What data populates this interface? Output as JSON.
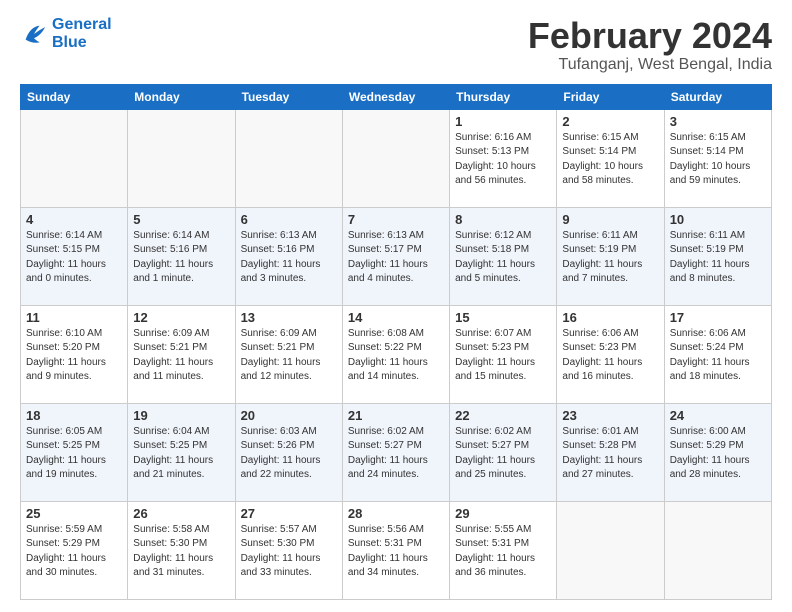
{
  "header": {
    "logo_line1": "General",
    "logo_line2": "Blue",
    "month": "February 2024",
    "location": "Tufanganj, West Bengal, India"
  },
  "weekdays": [
    "Sunday",
    "Monday",
    "Tuesday",
    "Wednesday",
    "Thursday",
    "Friday",
    "Saturday"
  ],
  "weeks": [
    [
      {
        "day": "",
        "info": ""
      },
      {
        "day": "",
        "info": ""
      },
      {
        "day": "",
        "info": ""
      },
      {
        "day": "",
        "info": ""
      },
      {
        "day": "1",
        "info": "Sunrise: 6:16 AM\nSunset: 5:13 PM\nDaylight: 10 hours\nand 56 minutes."
      },
      {
        "day": "2",
        "info": "Sunrise: 6:15 AM\nSunset: 5:14 PM\nDaylight: 10 hours\nand 58 minutes."
      },
      {
        "day": "3",
        "info": "Sunrise: 6:15 AM\nSunset: 5:14 PM\nDaylight: 10 hours\nand 59 minutes."
      }
    ],
    [
      {
        "day": "4",
        "info": "Sunrise: 6:14 AM\nSunset: 5:15 PM\nDaylight: 11 hours\nand 0 minutes."
      },
      {
        "day": "5",
        "info": "Sunrise: 6:14 AM\nSunset: 5:16 PM\nDaylight: 11 hours\nand 1 minute."
      },
      {
        "day": "6",
        "info": "Sunrise: 6:13 AM\nSunset: 5:16 PM\nDaylight: 11 hours\nand 3 minutes."
      },
      {
        "day": "7",
        "info": "Sunrise: 6:13 AM\nSunset: 5:17 PM\nDaylight: 11 hours\nand 4 minutes."
      },
      {
        "day": "8",
        "info": "Sunrise: 6:12 AM\nSunset: 5:18 PM\nDaylight: 11 hours\nand 5 minutes."
      },
      {
        "day": "9",
        "info": "Sunrise: 6:11 AM\nSunset: 5:19 PM\nDaylight: 11 hours\nand 7 minutes."
      },
      {
        "day": "10",
        "info": "Sunrise: 6:11 AM\nSunset: 5:19 PM\nDaylight: 11 hours\nand 8 minutes."
      }
    ],
    [
      {
        "day": "11",
        "info": "Sunrise: 6:10 AM\nSunset: 5:20 PM\nDaylight: 11 hours\nand 9 minutes."
      },
      {
        "day": "12",
        "info": "Sunrise: 6:09 AM\nSunset: 5:21 PM\nDaylight: 11 hours\nand 11 minutes."
      },
      {
        "day": "13",
        "info": "Sunrise: 6:09 AM\nSunset: 5:21 PM\nDaylight: 11 hours\nand 12 minutes."
      },
      {
        "day": "14",
        "info": "Sunrise: 6:08 AM\nSunset: 5:22 PM\nDaylight: 11 hours\nand 14 minutes."
      },
      {
        "day": "15",
        "info": "Sunrise: 6:07 AM\nSunset: 5:23 PM\nDaylight: 11 hours\nand 15 minutes."
      },
      {
        "day": "16",
        "info": "Sunrise: 6:06 AM\nSunset: 5:23 PM\nDaylight: 11 hours\nand 16 minutes."
      },
      {
        "day": "17",
        "info": "Sunrise: 6:06 AM\nSunset: 5:24 PM\nDaylight: 11 hours\nand 18 minutes."
      }
    ],
    [
      {
        "day": "18",
        "info": "Sunrise: 6:05 AM\nSunset: 5:25 PM\nDaylight: 11 hours\nand 19 minutes."
      },
      {
        "day": "19",
        "info": "Sunrise: 6:04 AM\nSunset: 5:25 PM\nDaylight: 11 hours\nand 21 minutes."
      },
      {
        "day": "20",
        "info": "Sunrise: 6:03 AM\nSunset: 5:26 PM\nDaylight: 11 hours\nand 22 minutes."
      },
      {
        "day": "21",
        "info": "Sunrise: 6:02 AM\nSunset: 5:27 PM\nDaylight: 11 hours\nand 24 minutes."
      },
      {
        "day": "22",
        "info": "Sunrise: 6:02 AM\nSunset: 5:27 PM\nDaylight: 11 hours\nand 25 minutes."
      },
      {
        "day": "23",
        "info": "Sunrise: 6:01 AM\nSunset: 5:28 PM\nDaylight: 11 hours\nand 27 minutes."
      },
      {
        "day": "24",
        "info": "Sunrise: 6:00 AM\nSunset: 5:29 PM\nDaylight: 11 hours\nand 28 minutes."
      }
    ],
    [
      {
        "day": "25",
        "info": "Sunrise: 5:59 AM\nSunset: 5:29 PM\nDaylight: 11 hours\nand 30 minutes."
      },
      {
        "day": "26",
        "info": "Sunrise: 5:58 AM\nSunset: 5:30 PM\nDaylight: 11 hours\nand 31 minutes."
      },
      {
        "day": "27",
        "info": "Sunrise: 5:57 AM\nSunset: 5:30 PM\nDaylight: 11 hours\nand 33 minutes."
      },
      {
        "day": "28",
        "info": "Sunrise: 5:56 AM\nSunset: 5:31 PM\nDaylight: 11 hours\nand 34 minutes."
      },
      {
        "day": "29",
        "info": "Sunrise: 5:55 AM\nSunset: 5:31 PM\nDaylight: 11 hours\nand 36 minutes."
      },
      {
        "day": "",
        "info": ""
      },
      {
        "day": "",
        "info": ""
      }
    ]
  ]
}
